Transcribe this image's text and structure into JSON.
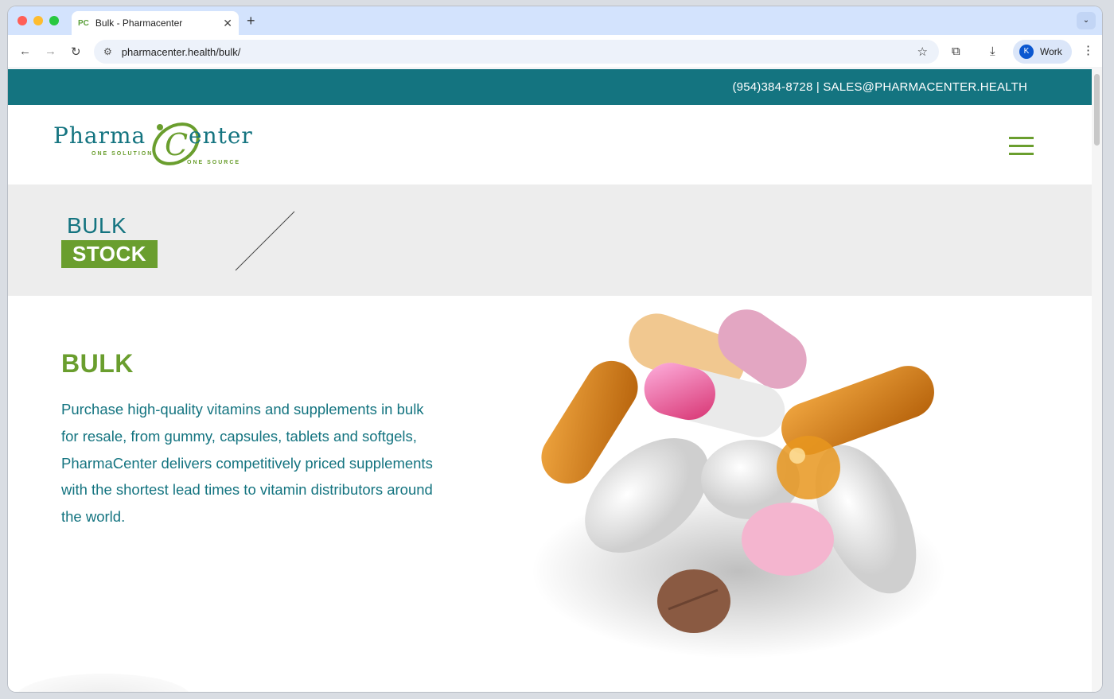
{
  "browser": {
    "tab_title": "Bulk - Pharmacenter",
    "tab_favicon": "PC",
    "url": "pharmacenter.health/bulk/",
    "profile_initial": "K",
    "profile_label": "Work"
  },
  "site": {
    "contact_line": "(954)384-8728 | SALES@PHARMACENTER.HEALTH",
    "logo": {
      "word_left": "Pharma",
      "word_right": "enter",
      "tag_left": "ONE SOLUTION",
      "tag_right": "ONE SOURCE"
    },
    "banner": {
      "line1": "BULK",
      "line2": "STOCK"
    },
    "section": {
      "heading": "BULK",
      "body": "Purchase high-quality vitamins and supplements in bulk for resale, from gummy, capsules, tablets and softgels, PharmaCenter delivers competitively priced supplements with the shortest lead times to vitamin distributors around the world."
    }
  },
  "colors": {
    "teal": "#147480",
    "green": "#6a9e2e",
    "banner_bg": "#ededed"
  },
  "icons": [
    "back-icon",
    "forward-icon",
    "reload-icon",
    "site-settings-icon",
    "bookmark-star-icon",
    "extensions-icon",
    "download-icon",
    "menu-icon",
    "hamburger-menu-icon"
  ]
}
